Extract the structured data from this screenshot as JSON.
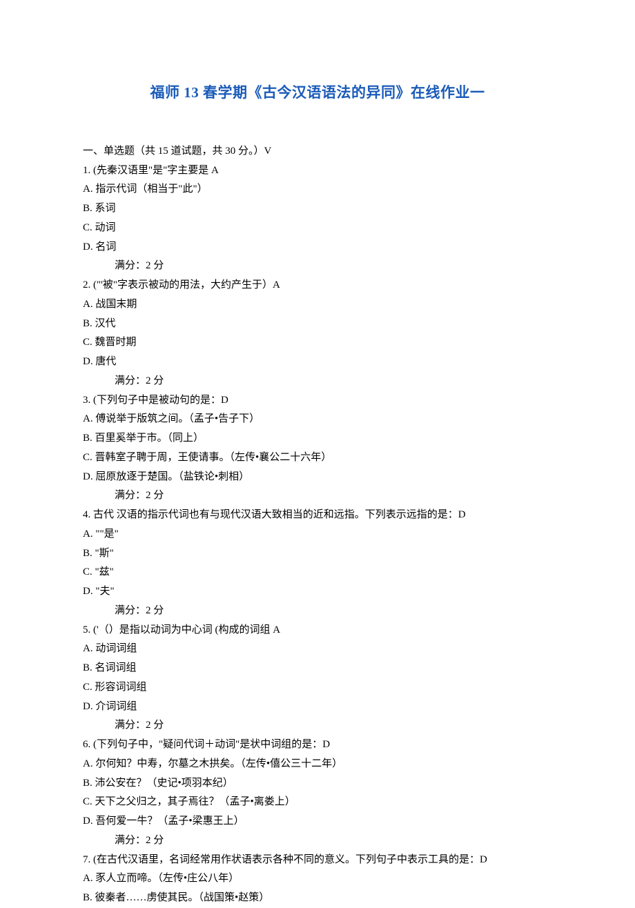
{
  "title": "福师 13 春学期《古今汉语语法的异同》在线作业一",
  "section_header": "一、单选题（共 15 道试题，共 30 分。）V",
  "questions": [
    {
      "num": "1.",
      "text": "  (先秦汉语里\"是\"字主要是 A",
      "options": [
        "A.  指示代词（相当于\"此\"）",
        "B.  系词",
        "C.  动词",
        "D.  名词"
      ],
      "score": "满分：2   分"
    },
    {
      "num": "2.",
      "text": "  (\"'被\"字表示被动的用法，大约产生于）A",
      "options": [
        "A.  战国末期",
        "B.  汉代",
        "C.  魏晋时期",
        "D.  唐代"
      ],
      "score": "满分：2   分"
    },
    {
      "num": "3.",
      "text": "  (下列句子中是被动句的是：D",
      "options": [
        "A.  傅说举于版筑之间。（孟子•告子下）",
        "B.  百里奚举于市。（同上）",
        "C.  晋韩室子聘于周，王使请事。（左传•襄公二十六年）",
        "D.  屈原放逐于楚国。（盐铁论•刺相）"
      ],
      "score": "满分：2   分"
    },
    {
      "num": "4.",
      "text": "   古代 汉语的指示代词也有与现代汉语大致相当的近和远指。下列表示远指的是：D",
      "options": [
        "A. \"\"是\"",
        "B. \"斯\"",
        "C. \"兹\"",
        "D. \"夫\""
      ],
      "score": "满分：2   分"
    },
    {
      "num": "5.",
      "text": "  ('（）是指以动词为中心词 (构成的词组 A",
      "options": [
        "A.  动词词组",
        "B.  名词词组",
        "C.  形容词词组",
        "D.  介词词组"
      ],
      "score": "满分：2   分"
    },
    {
      "num": "6.",
      "text": "  (下列句子中，\"疑问代词＋动词\"是状中词组的是：D",
      "options": [
        "A.  尔何知？中寿，尔墓之木拱矣。（左传•僖公三十二年）",
        "B.  沛公安在？（史记•项羽本纪）",
        "C.  天下之父归之，其子焉往？（孟子•离娄上）",
        "D.  吾何爱一牛？（孟子•梁惠王上）"
      ],
      "score": "满分：2   分"
    },
    {
      "num": "7.",
      "text": "  (在古代汉语里，名词经常用作状语表示各种不同的意义。下列句子中表示工具的是：D",
      "options": [
        "A.  豕人立而啼。（左传•庄公八年）",
        "B.  彼秦者……虏使其民。（战国策•赵策）"
      ],
      "score": ""
    }
  ]
}
